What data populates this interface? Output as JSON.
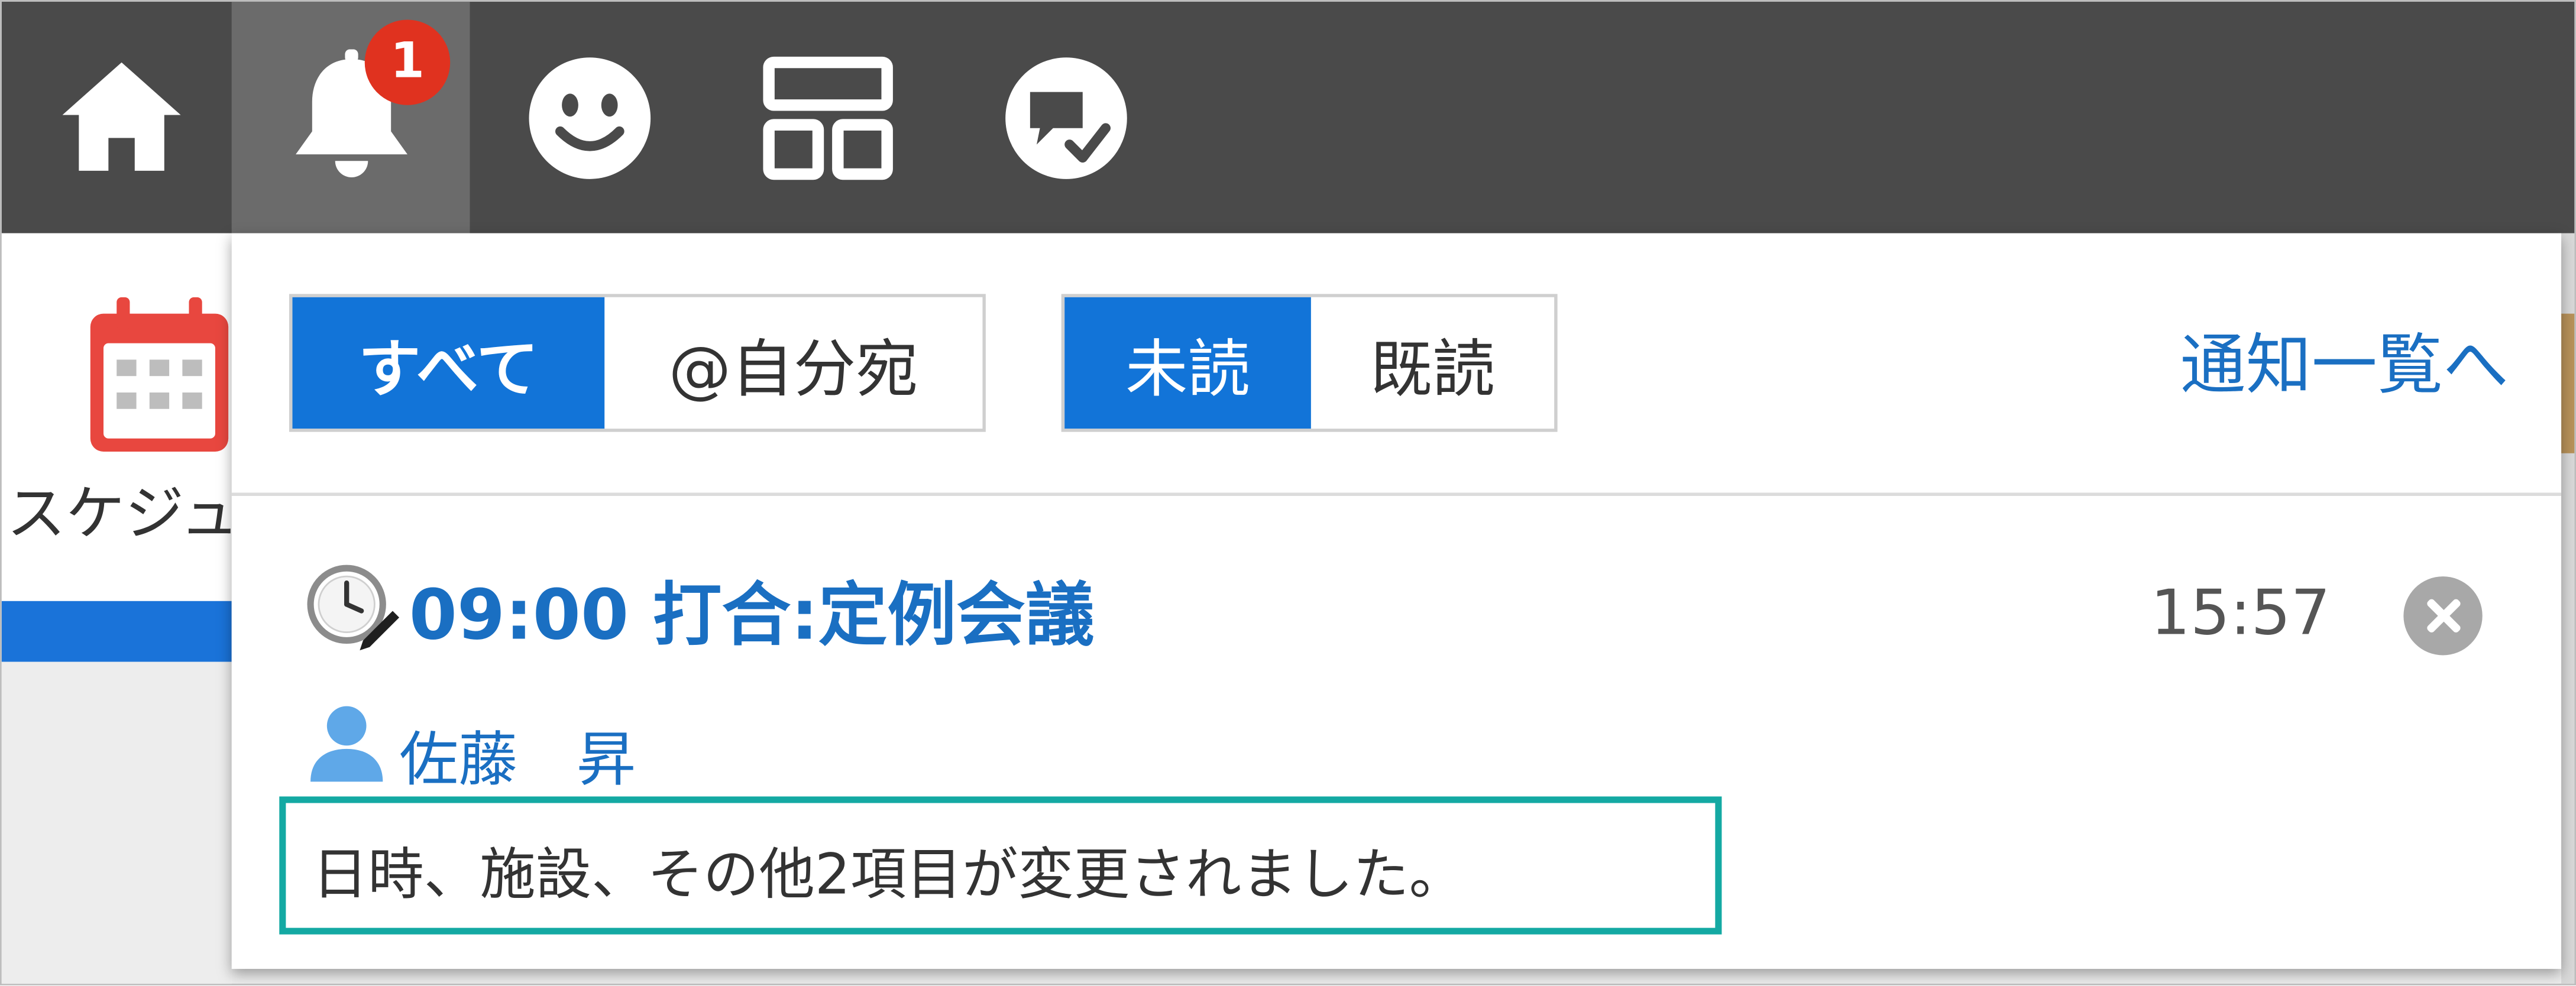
{
  "header": {
    "nav": [
      {
        "name": "home",
        "icon": "home-icon"
      },
      {
        "name": "notifications",
        "icon": "bell-icon",
        "active": true,
        "badge": "1"
      },
      {
        "name": "people",
        "icon": "smiley-icon"
      },
      {
        "name": "portal",
        "icon": "layout-icon"
      },
      {
        "name": "messages",
        "icon": "chat-check-icon"
      }
    ],
    "badge_count": "1"
  },
  "background_app": {
    "icon": "calendar-icon",
    "label": "スケジュ"
  },
  "popup": {
    "filter_tabs": [
      {
        "label": "すべて",
        "selected": true
      },
      {
        "label": "@自分宛",
        "selected": false
      }
    ],
    "read_tabs": [
      {
        "label": "未読",
        "selected": true
      },
      {
        "label": "既読",
        "selected": false
      }
    ],
    "list_link": "通知一覧へ",
    "notification": {
      "icon": "clock-pen-icon",
      "title": "09:00 打合:定例会議",
      "time": "15:57",
      "user_icon": "user-icon",
      "user": "佐藤　昇",
      "message": "日時、施設、その他2項目が変更されました。"
    }
  },
  "colors": {
    "header_bg": "#4a4a4a",
    "active_nav_bg": "#6b6b6b",
    "badge": "#e0321f",
    "primary_blue": "#1274d8",
    "link_blue": "#1a6fc2",
    "highlight_border": "#14a9a3"
  }
}
